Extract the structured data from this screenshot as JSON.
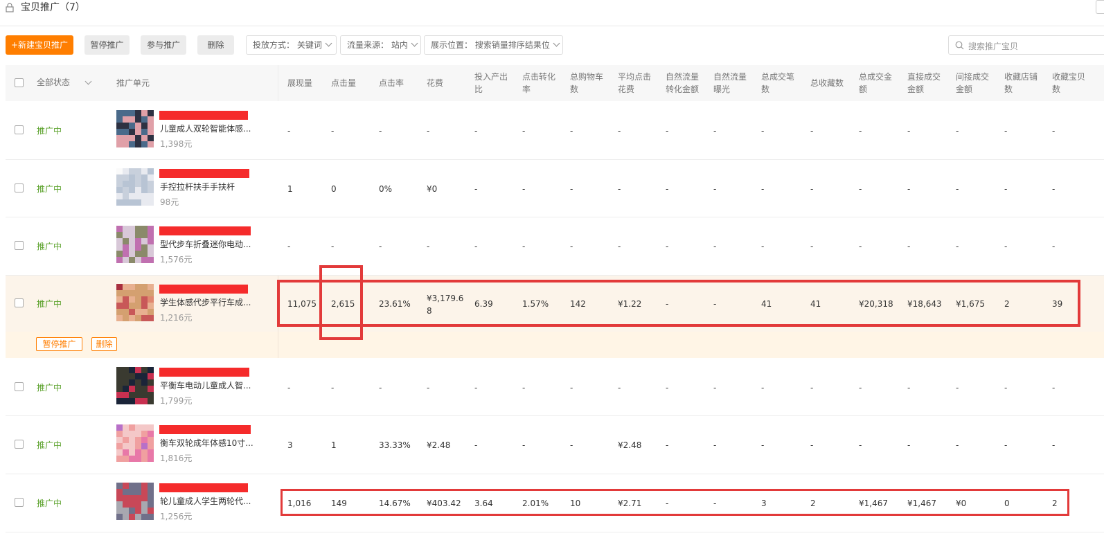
{
  "page": {
    "title": "宝贝推广（7）"
  },
  "toolbar": {
    "new_label": "+新建宝贝推广",
    "pause_label": "暂停推广",
    "join_label": "参与推广",
    "delete_label": "删除",
    "filter_bid": "投放方式：  关键词",
    "filter_source": "流量来源：  站内",
    "filter_position": "展示位置：  搜索销量排序结果位",
    "search_placeholder": "搜索推广宝贝"
  },
  "table": {
    "status_header": "全部状态",
    "unit_header": "推广单元",
    "columns": [
      [
        "展现量"
      ],
      [
        "点击量"
      ],
      [
        "点击率"
      ],
      [
        "花费"
      ],
      [
        "投入产出",
        "比"
      ],
      [
        "点击转化",
        "率"
      ],
      [
        "总购物车",
        "数"
      ],
      [
        "平均点击",
        "花费"
      ],
      [
        "自然流量",
        "转化金额"
      ],
      [
        "自然流量",
        "曝光"
      ],
      [
        "总成交笔",
        "数"
      ],
      [
        "总收藏数"
      ],
      [
        "总成交金",
        "额"
      ],
      [
        "直接成交",
        "金额"
      ],
      [
        "间接成交",
        "金额"
      ],
      [
        "收藏店铺",
        "数"
      ],
      [
        "收藏宝贝",
        "数"
      ]
    ],
    "rows": [
      {
        "status": "推广中",
        "name": "儿童成人双轮智能体感...",
        "price": "1,398元",
        "cells": [
          "-",
          "-",
          "-",
          "-",
          "-",
          "-",
          "-",
          "-",
          "-",
          "-",
          "-",
          "-",
          "-",
          "-",
          "-",
          "-",
          "-"
        ]
      },
      {
        "status": "推广中",
        "name": "手控拉杆扶手手扶杆",
        "price": "98元",
        "cells": [
          "1",
          "0",
          "0%",
          "¥0",
          "-",
          "-",
          "-",
          "-",
          "-",
          "-",
          "-",
          "-",
          "-",
          "-",
          "-",
          "-",
          "-"
        ]
      },
      {
        "status": "推广中",
        "name": "型代步车折叠迷你电动...",
        "price": "1,576元",
        "cells": [
          "-",
          "-",
          "-",
          "-",
          "-",
          "-",
          "-",
          "-",
          "-",
          "-",
          "-",
          "-",
          "-",
          "-",
          "-",
          "-",
          "-"
        ]
      },
      {
        "status": "推广中",
        "name": "学生体感代步平行车成...",
        "price": "1,216元",
        "cells": [
          "11,075",
          "2,615",
          "23.61%",
          "¥3,179.6\n8",
          "6.39",
          "1.57%",
          "142",
          "¥1.22",
          "-",
          "-",
          "41",
          "41",
          "¥20,318",
          "¥18,643",
          "¥1,675",
          "2",
          "39"
        ],
        "actions": {
          "pause": "暂停推广",
          "delete": "删除"
        }
      },
      {
        "status": "推广中",
        "name": "平衡车电动儿童成人智...",
        "price": "1,799元",
        "cells": [
          "-",
          "-",
          "-",
          "-",
          "-",
          "-",
          "-",
          "-",
          "-",
          "-",
          "-",
          "-",
          "-",
          "-",
          "-",
          "-",
          "-"
        ]
      },
      {
        "status": "推广中",
        "name": "衡车双轮成年体感10寸...",
        "price": "1,816元",
        "cells": [
          "3",
          "1",
          "33.33%",
          "¥2.48",
          "-",
          "-",
          "-",
          "¥2.48",
          "-",
          "-",
          "-",
          "-",
          "-",
          "-",
          "-",
          "-",
          "-"
        ]
      },
      {
        "status": "推广中",
        "name": "轮儿童成人学生两轮代...",
        "price": "1,256元",
        "cells": [
          "1,016",
          "149",
          "14.67%",
          "¥403.42",
          "3.64",
          "2.01%",
          "10",
          "¥2.71",
          "-",
          "-",
          "3",
          "2",
          "¥1,467",
          "¥1,467",
          "¥0",
          "0",
          "2"
        ]
      }
    ]
  },
  "colors": {
    "accent": "#ff7e00",
    "status": "#5aa12a",
    "annotation": "#e23a3a",
    "redaction": "#f52b2b"
  }
}
